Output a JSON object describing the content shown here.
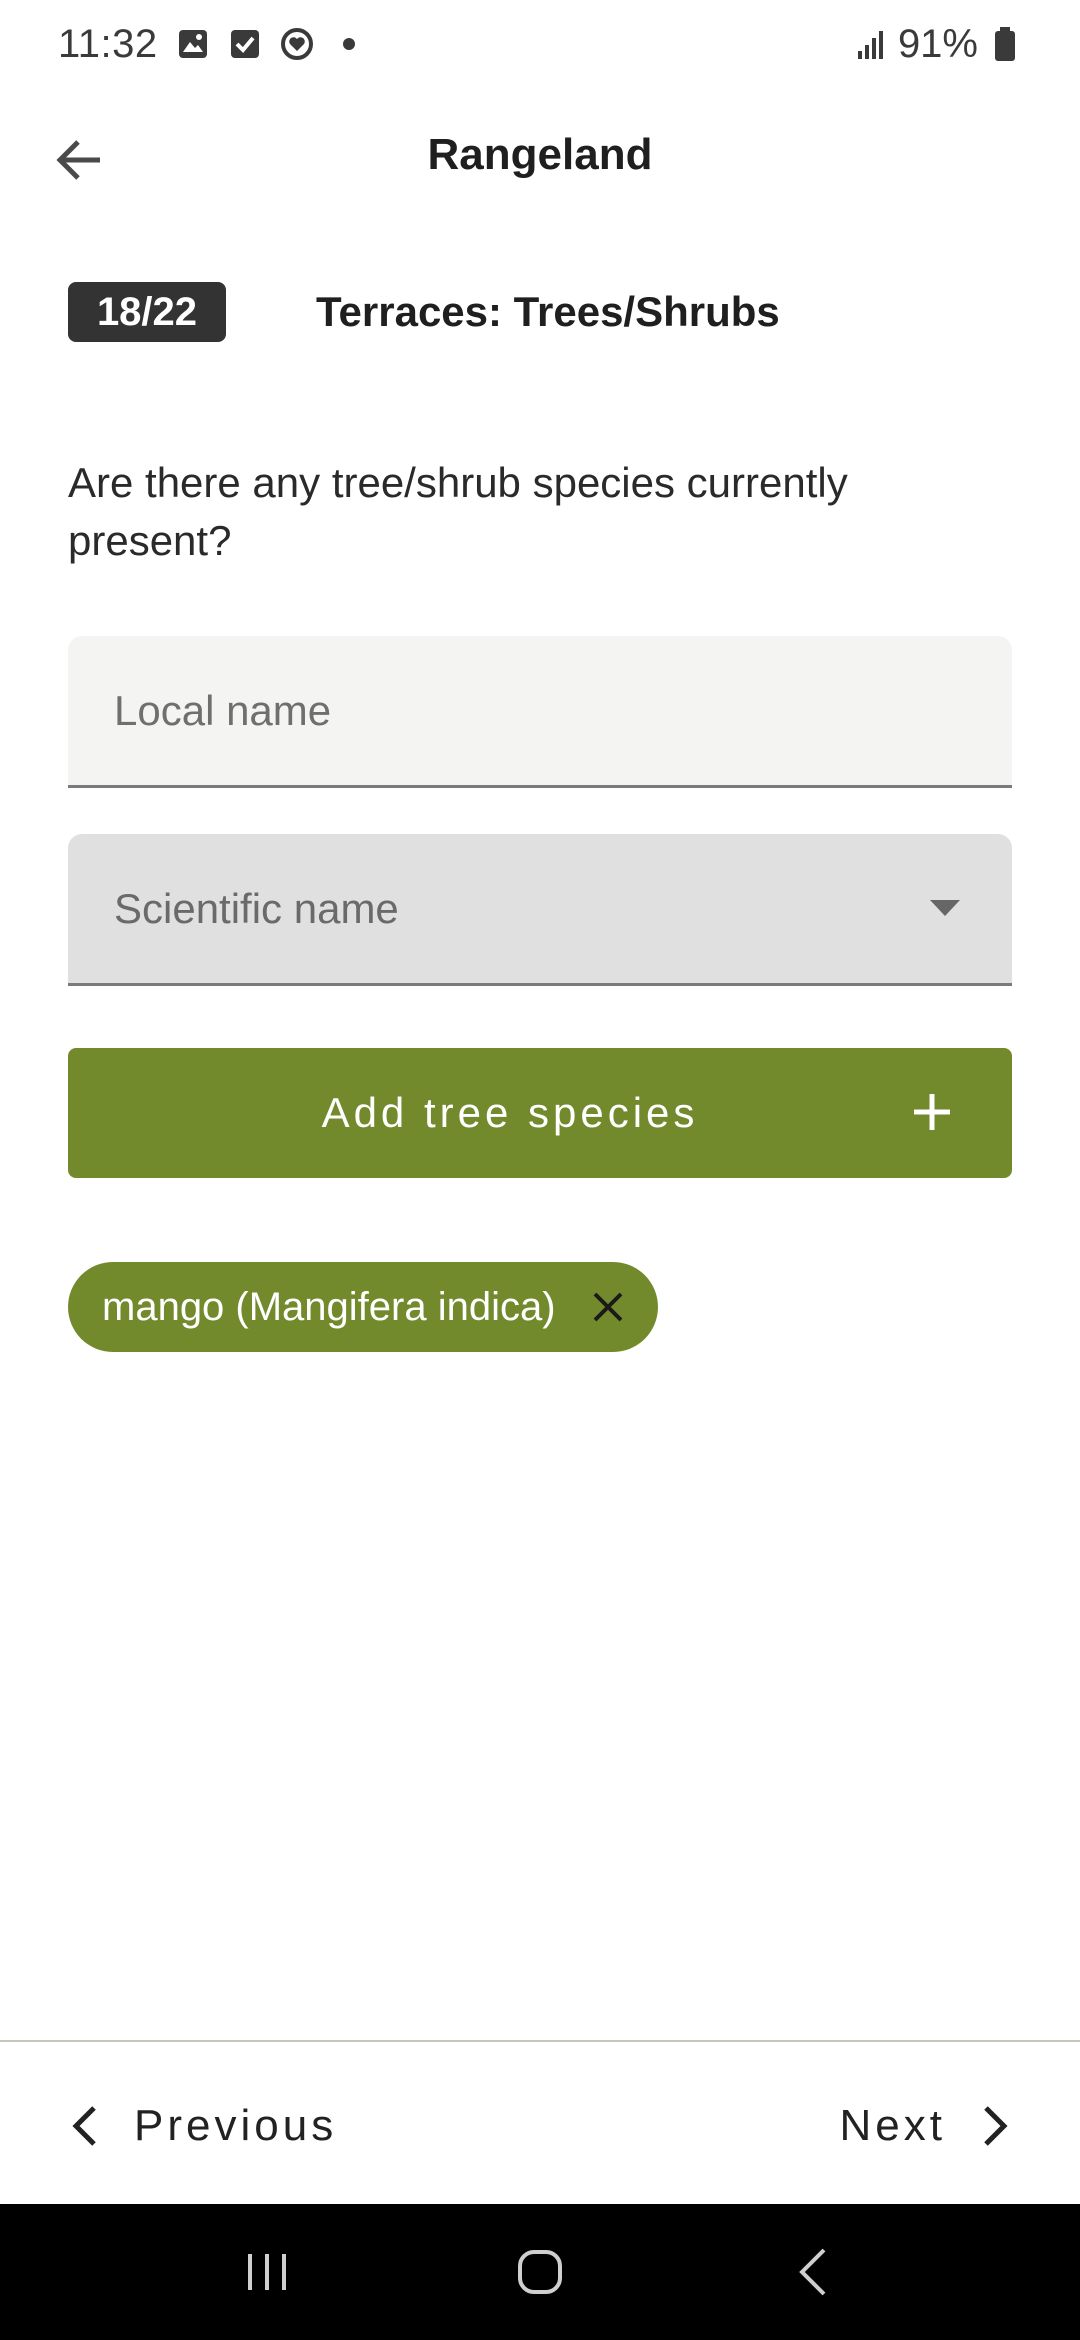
{
  "status_bar": {
    "time": "11:32",
    "battery": "91%",
    "icons": [
      "gallery-icon",
      "checkbox-icon",
      "heart-ring-icon",
      "dot-icon",
      "signal-icon",
      "battery-icon"
    ]
  },
  "app_bar": {
    "title": "Rangeland",
    "back_icon": "arrow-left-icon"
  },
  "question": {
    "badge": "18/22",
    "section": "Terraces: Trees/Shrubs",
    "text": "Are there any tree/shrub species currently present?"
  },
  "form": {
    "local_name_placeholder": "Local name",
    "local_name_value": "",
    "scientific_name_placeholder": "Scientific name",
    "add_button_label": "Add tree species"
  },
  "chips": [
    {
      "label": "mango (Mangifera indica)"
    }
  ],
  "navigation": {
    "previous_label": "Previous",
    "next_label": "Next"
  },
  "colors": {
    "accent": "#738a2c",
    "badge_bg": "#333333",
    "field_bg": "#f4f4f3",
    "select_bg": "#e0e0e0"
  }
}
